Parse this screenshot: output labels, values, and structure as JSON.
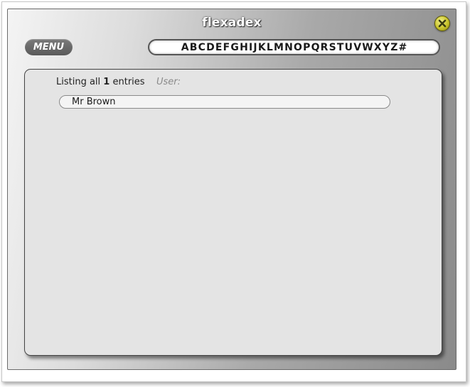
{
  "app": {
    "title": "flexadex",
    "menu_label": "MENU",
    "close_icon": "close-icon",
    "accent_color": "#c9c32b"
  },
  "alphabet": [
    "A",
    "B",
    "C",
    "D",
    "E",
    "F",
    "G",
    "H",
    "I",
    "J",
    "K",
    "L",
    "M",
    "N",
    "O",
    "P",
    "Q",
    "R",
    "S",
    "T",
    "U",
    "V",
    "W",
    "X",
    "Y",
    "Z",
    "#"
  ],
  "listing": {
    "prefix": "Listing all",
    "count": "1",
    "suffix": "entries",
    "user_label": "User:"
  },
  "entries": [
    {
      "name": "Mr Brown"
    }
  ]
}
